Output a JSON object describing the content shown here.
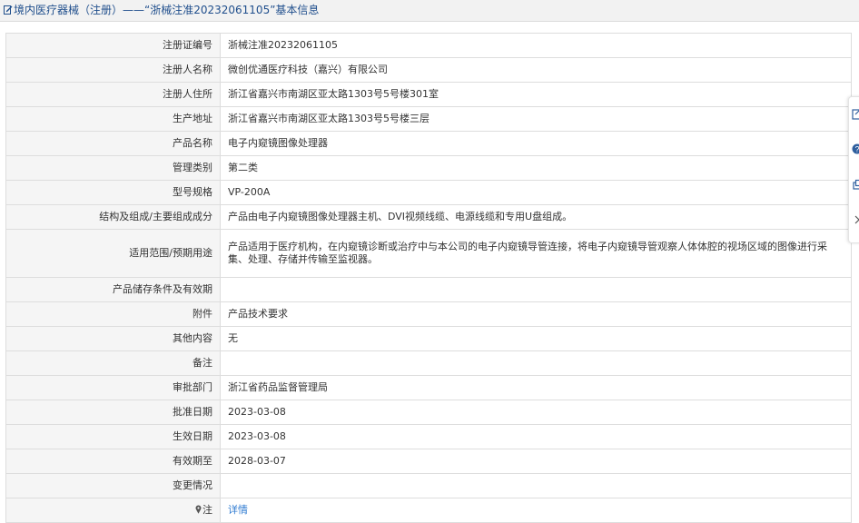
{
  "page": {
    "title": "境内医疗器械（注册）——“浙械注准20232061105”基本信息"
  },
  "rows": [
    {
      "label": "注册证编号",
      "value": "浙械注准20232061105"
    },
    {
      "label": "注册人名称",
      "value": "微创优通医疗科技（嘉兴）有限公司"
    },
    {
      "label": "注册人住所",
      "value": "浙江省嘉兴市南湖区亚太路1303号5号楼301室"
    },
    {
      "label": "生产地址",
      "value": "浙江省嘉兴市南湖区亚太路1303号5号楼三层"
    },
    {
      "label": "产品名称",
      "value": "电子内窥镜图像处理器"
    },
    {
      "label": "管理类别",
      "value": "第二类"
    },
    {
      "label": "型号规格",
      "value": "VP-200A"
    },
    {
      "label": "结构及组成/主要组成成分",
      "value": "产品由电子内窥镜图像处理器主机、DVI视频线缆、电源线缆和专用U盘组成。"
    },
    {
      "label": "适用范围/预期用途",
      "value": "产品适用于医疗机构，在内窥镜诊断或治疗中与本公司的电子内窥镜导管连接，将电子内窥镜导管观察人体体腔的视场区域的图像进行采集、处理、存储并传输至监视器。"
    },
    {
      "label": "产品储存条件及有效期",
      "value": ""
    },
    {
      "label": "附件",
      "value": "产品技术要求"
    },
    {
      "label": "其他内容",
      "value": "无"
    },
    {
      "label": "备注",
      "value": ""
    },
    {
      "label": "审批部门",
      "value": "浙江省药品监督管理局"
    },
    {
      "label": "批准日期",
      "value": "2023-03-08"
    },
    {
      "label": "生效日期",
      "value": "2023-03-08"
    },
    {
      "label": "有效期至",
      "value": "2028-03-07"
    },
    {
      "label": "变更情况",
      "value": ""
    },
    {
      "label": "注",
      "value": "详情"
    }
  ],
  "icons": {
    "title": "edit-icon",
    "note": "pin-icon",
    "side": [
      "feedback-icon",
      "help-icon",
      "share-icon",
      "collapse-icon"
    ]
  },
  "colors": {
    "title": "#1f4e8c",
    "link": "#2f7bd1",
    "label_bg": "#f5f5f5",
    "border": "#dddddd"
  }
}
